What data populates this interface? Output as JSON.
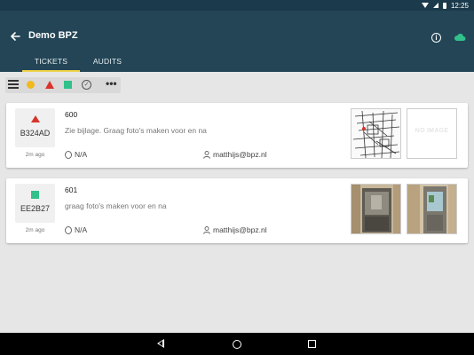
{
  "status_bar": {
    "time": "12:25"
  },
  "app_bar": {
    "title": "Demo BPZ"
  },
  "tabs": [
    {
      "label": "TICKETS",
      "active": true
    },
    {
      "label": "AUDITS",
      "active": false
    }
  ],
  "toolbar": {
    "more_label": "•••"
  },
  "tickets": [
    {
      "number": "600",
      "code": "B324AD",
      "priority_icon": "red-triangle",
      "age": "2m ago",
      "description": "Zie bijlage. Graag foto's maken voor en na",
      "due": "N/A",
      "assignee": "matthijs@bpz.nl",
      "thumbnails": [
        "floor-plan-sketch",
        "no-image-placeholder"
      ],
      "placeholder_text": "NO IMAGE"
    },
    {
      "number": "601",
      "code": "EE2B27",
      "priority_icon": "green-square",
      "age": "2m ago",
      "description": "graag foto's maken voor en na",
      "due": "N/A",
      "assignee": "matthijs@bpz.nl",
      "thumbnails": [
        "door-photo-1",
        "door-photo-2"
      ]
    }
  ],
  "colors": {
    "app_bar": "#234556",
    "status_bar": "#1b3a4b",
    "tab_indicator": "#f0d24a",
    "priority_red": "#d9342b",
    "priority_yellow": "#f2b91f",
    "priority_green": "#32c08b",
    "cloud": "#32c08b"
  }
}
